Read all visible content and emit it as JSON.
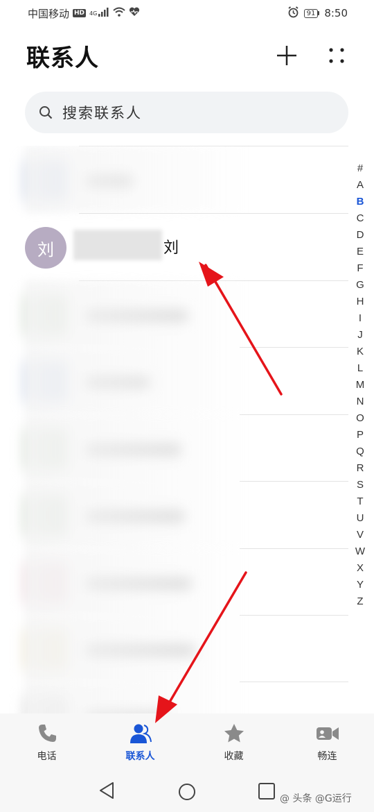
{
  "status_bar": {
    "carrier": "中国移动",
    "hd_badge": "HD",
    "network": "4G",
    "battery": "91",
    "time": "8:50"
  },
  "header": {
    "title": "联系人",
    "icons": [
      "plus-icon",
      "more-dots-icon"
    ]
  },
  "search": {
    "placeholder": "搜索联系人",
    "icon": "search-icon"
  },
  "contacts": {
    "featured": {
      "avatar_initial": "刘",
      "name_suffix": "刘"
    }
  },
  "alpha_index": {
    "letters": [
      "#",
      "A",
      "B",
      "C",
      "D",
      "E",
      "F",
      "G",
      "H",
      "I",
      "J",
      "K",
      "L",
      "M",
      "N",
      "O",
      "P",
      "Q",
      "R",
      "S",
      "T",
      "U",
      "V",
      "W",
      "X",
      "Y",
      "Z"
    ],
    "active": "B"
  },
  "bottom_nav": {
    "tabs": [
      {
        "label": "电话",
        "icon": "phone-icon"
      },
      {
        "label": "联系人",
        "icon": "contacts-icon"
      },
      {
        "label": "收藏",
        "icon": "star-icon"
      },
      {
        "label": "畅连",
        "icon": "video-call-icon"
      }
    ],
    "active": "联系人"
  },
  "system_nav": {
    "icons": [
      "back-icon",
      "home-icon",
      "recent-apps-icon"
    ]
  },
  "watermark": "@ 头条 @G运行",
  "colors": {
    "accent": "#1a56d6",
    "avatar": "#b7acc2",
    "search_bg": "#f1f3f5",
    "arrow": "#e5141a"
  }
}
